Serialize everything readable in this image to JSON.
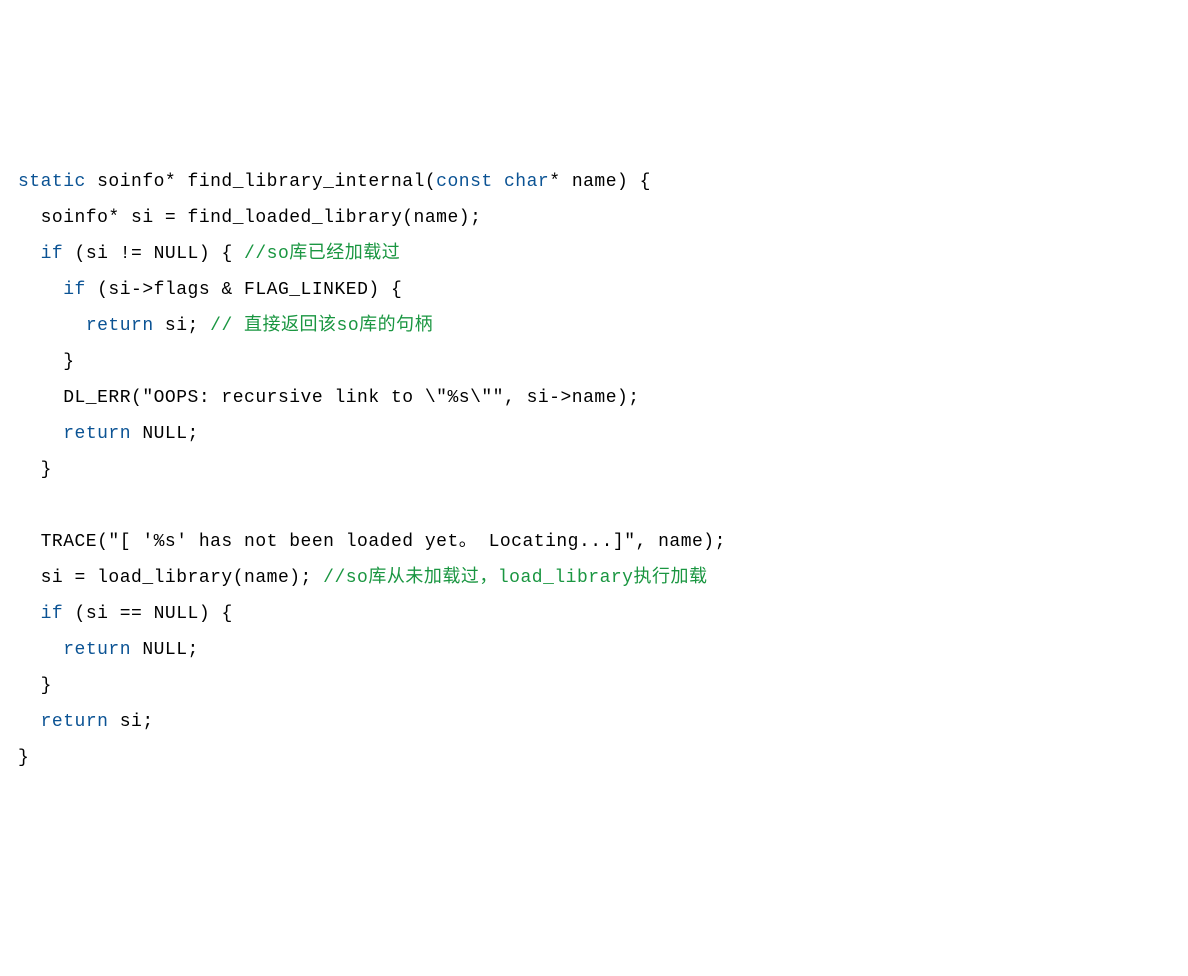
{
  "code": {
    "l1": {
      "t1": "static",
      "t2": " soinfo* find_library_internal(",
      "t3": "const",
      "t4": " ",
      "t5": "char",
      "t6": "* name) {"
    },
    "l2": {
      "t1": "  soinfo* si = find_loaded_library(name);"
    },
    "l3": {
      "t1": "  ",
      "t2": "if",
      "t3": " (si != NULL) { ",
      "t4": "//so库已经加载过"
    },
    "l4": {
      "t1": "    ",
      "t2": "if",
      "t3": " (si->flags & FLAG_LINKED) {"
    },
    "l5": {
      "t1": "      ",
      "t2": "return",
      "t3": " si; ",
      "t4": "// 直接返回该so库的句柄"
    },
    "l6": {
      "t1": "    }"
    },
    "l7": {
      "t1": "    DL_ERR(\"OOPS: recursive link to \\\"%s\\\"\", si->name);"
    },
    "l8": {
      "t1": "    ",
      "t2": "return",
      "t3": " NULL;"
    },
    "l9": {
      "t1": "  }"
    },
    "l10": {
      "t1": ""
    },
    "l11": {
      "t1": "  TRACE(\"[ '%s' has not been loaded yet。 Locating...]\", name);"
    },
    "l12": {
      "t1": "  si = load_library(name); ",
      "t2": "//so库从未加载过，load_library执行加载"
    },
    "l13": {
      "t1": "  ",
      "t2": "if",
      "t3": " (si == NULL) {"
    },
    "l14": {
      "t1": "    ",
      "t2": "return",
      "t3": " NULL;"
    },
    "l15": {
      "t1": "  }"
    },
    "l16": {
      "t1": "  ",
      "t2": "return",
      "t3": " si;"
    },
    "l17": {
      "t1": "}"
    }
  }
}
